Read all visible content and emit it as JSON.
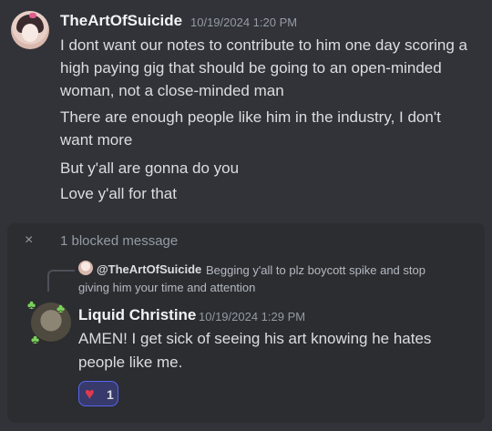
{
  "message1": {
    "author": "TheArtOfSuicide",
    "timestamp": "10/19/2024 1:20 PM",
    "lines": [
      "I dont want our notes to contribute to him one day scoring a",
      "high paying gig that should be going to an open-minded",
      "woman, not a close-minded man",
      "There are enough people like him in the industry, I don't",
      "want more",
      "But y'all are gonna do you",
      "Love y'all for that"
    ]
  },
  "blocked": {
    "label": "1 blocked message",
    "close_icon": "×"
  },
  "reply": {
    "mention": "@TheArtOfSuicide",
    "text_line1": "Begging y'all to plz boycott spike and stop",
    "text_line2": "giving him your time and attention"
  },
  "message2": {
    "author": "Liquid Christine",
    "timestamp": "10/19/2024 1:29 PM",
    "lines": [
      "AMEN!  I get sick of seeing his art knowing he hates",
      "people like me."
    ]
  },
  "reaction": {
    "emoji": "heart",
    "glyph": "♥",
    "count": "1"
  },
  "colors": {
    "background": "#313338",
    "panel": "#2b2d31",
    "accent": "#5865f2",
    "heart": "#e03a4e"
  }
}
